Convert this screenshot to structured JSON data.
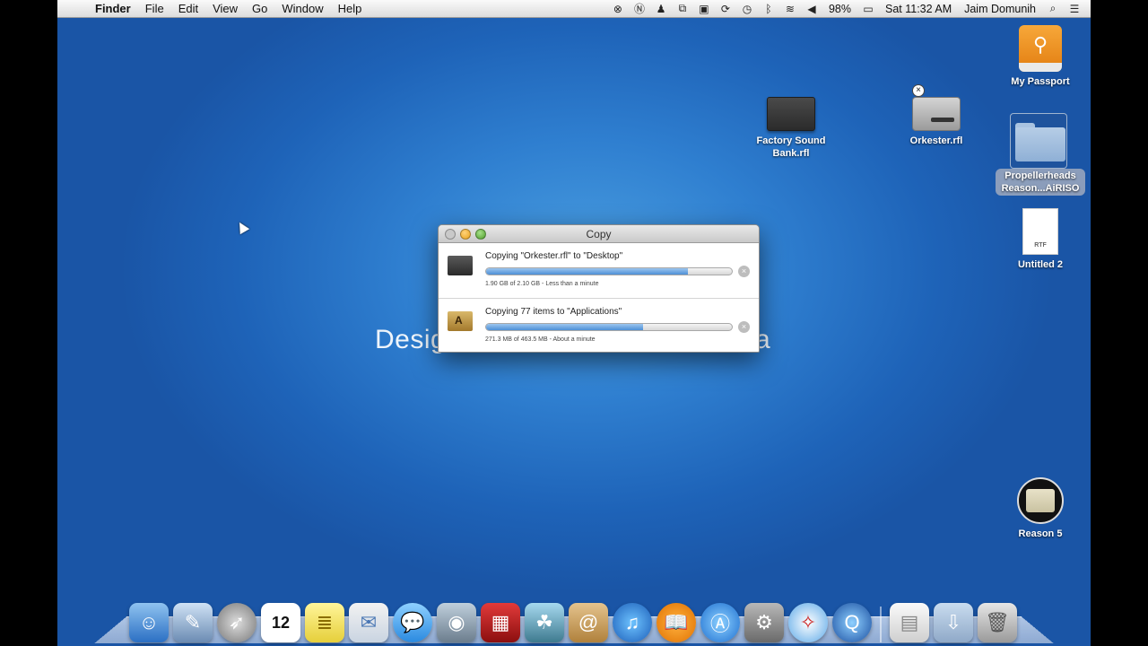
{
  "menubar": {
    "apple": "",
    "items": [
      "Finder",
      "File",
      "Edit",
      "View",
      "Go",
      "Window",
      "Help"
    ],
    "battery": "98%",
    "clock": "Sat 11:32 AM",
    "user": "Jaim Domunih"
  },
  "wallpaper": {
    "text_visible_left": "Desig",
    "text_visible_right": "a"
  },
  "desktop_icons": [
    {
      "label": "My Passport",
      "icon": "external-drive-icon"
    },
    {
      "label": "Factory Sound Bank.rfl",
      "icon": "disk-image-icon"
    },
    {
      "label": "Orkester.rfl",
      "icon": "mounted-disk-icon"
    },
    {
      "label": "Propellerheads Reason...AiRISO",
      "icon": "folder-icon"
    },
    {
      "label": "Untitled 2",
      "icon": "document-icon",
      "file_tag": "RTF"
    },
    {
      "label": "Reason 5",
      "icon": "reason-app-icon"
    }
  ],
  "copy_window": {
    "title": "Copy",
    "rows": [
      {
        "title": "Copying \"Orkester.rfl\" to \"Desktop\"",
        "progress": 0.82,
        "status": "1.90 GB of 2.10 GB - Less than a minute"
      },
      {
        "title": "Copying 77 items to \"Applications\"",
        "progress": 0.64,
        "status": "271.3 MB of 463.5 MB - About a minute"
      }
    ]
  },
  "dock": {
    "items": [
      "finder",
      "preview",
      "launchpad",
      "calendar",
      "notes",
      "mail",
      "messages",
      "facetime",
      "photo-booth",
      "iphoto",
      "contacts",
      "itunes",
      "ibooks",
      "app-store",
      "system-preferences",
      "safari",
      "quicktime",
      "documents",
      "downloads",
      "trash"
    ],
    "calendar_day": "12"
  }
}
